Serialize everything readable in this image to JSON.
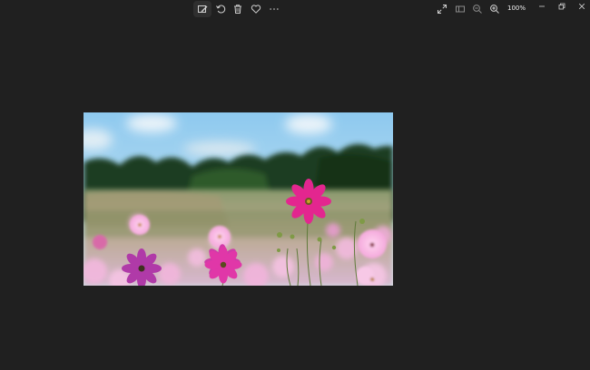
{
  "toolbar": {
    "buttons": [
      {
        "name": "edit-icon"
      },
      {
        "name": "rotate-icon"
      },
      {
        "name": "delete-icon"
      },
      {
        "name": "heart-icon"
      },
      {
        "name": "more-icon"
      }
    ]
  },
  "view": {
    "zoom_level": "100%"
  },
  "colors": {
    "background": "#202020",
    "toolbar_active": "#2f2f2f",
    "icon": "#d0d0d0"
  }
}
